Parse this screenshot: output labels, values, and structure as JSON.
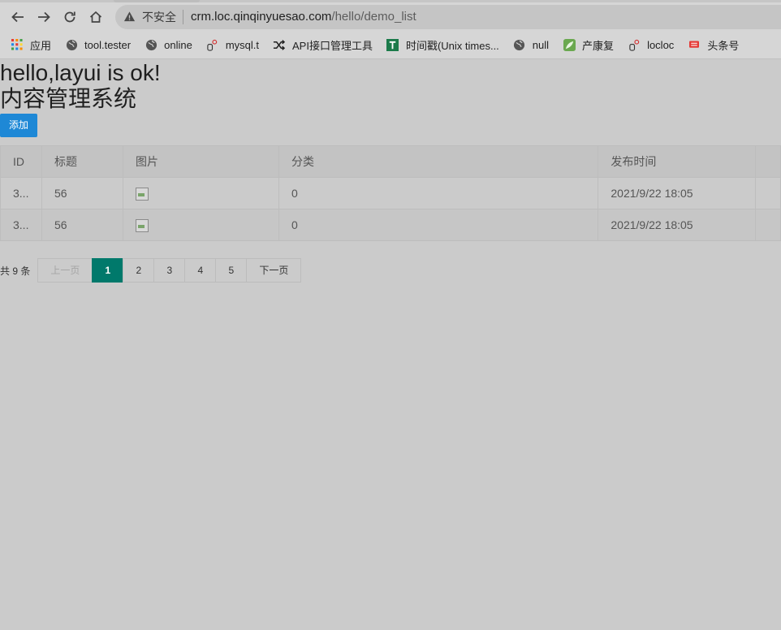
{
  "browser": {
    "insecure_label": "不安全",
    "url_host": "crm.loc.qinqinyuesao.com",
    "url_path": "/hello/demo_list",
    "bookmarks": [
      {
        "label": "应用",
        "icon": "apps-grid-icon"
      },
      {
        "label": "tool.tester",
        "icon": "globe-icon"
      },
      {
        "label": "online",
        "icon": "globe-icon"
      },
      {
        "label": "mysql.t",
        "icon": "dbeaver-icon"
      },
      {
        "label": "API接口管理工具",
        "icon": "shuffle-icon"
      },
      {
        "label": "时间戳(Unix times...",
        "icon": "t-square-icon"
      },
      {
        "label": "null",
        "icon": "globe-icon"
      },
      {
        "label": "产康复",
        "icon": "leaf-icon"
      },
      {
        "label": "locloc",
        "icon": "dbeaver-icon"
      },
      {
        "label": "头条号",
        "icon": "toutiao-icon"
      }
    ]
  },
  "page": {
    "greeting": "hello,layui is ok!",
    "title": "内容管理系统",
    "add_button": "添加"
  },
  "table": {
    "headers": [
      "ID",
      "标题",
      "图片",
      "分类",
      "发布时间"
    ],
    "rows": [
      {
        "id": "3...",
        "title": "56",
        "category": "0",
        "time": "2021/9/22 18:05"
      },
      {
        "id": "3...",
        "title": "56",
        "category": "0",
        "time": "2021/9/22 18:05"
      }
    ]
  },
  "pager": {
    "count": "共 9 条",
    "prev": "上一页",
    "pages": [
      "1",
      "2",
      "3",
      "4",
      "5"
    ],
    "next": "下一页"
  },
  "colors": {
    "add_button": "#1e88d6",
    "active_page": "#00796b"
  }
}
